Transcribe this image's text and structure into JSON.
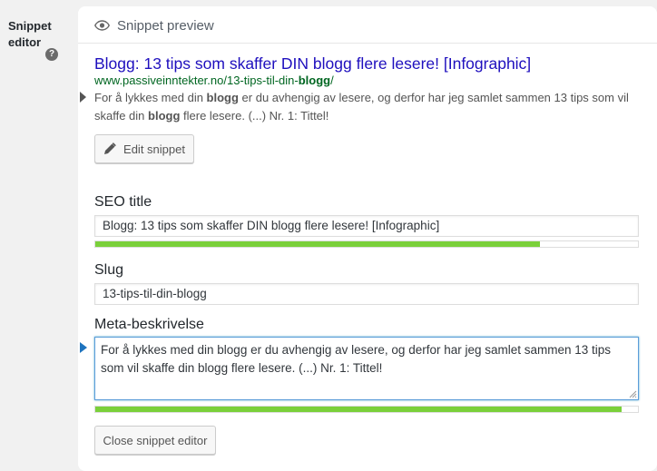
{
  "sidebar": {
    "label": "Snippet editor"
  },
  "preview": {
    "header": "Snippet preview",
    "serp_title": "Blogg: 13 tips som skaffer DIN blogg flere lesere! [Infographic]",
    "serp_url_prefix": "www.passiveinntekter.no/13-tips-til-din-",
    "serp_url_bold": "blogg",
    "serp_url_suffix": "/",
    "serp_desc_1": "For å lykkes med din ",
    "serp_desc_bold_1": "blogg",
    "serp_desc_2": " er du avhengig av lesere, og derfor har jeg samlet sammen 13 tips som vil skaffe din ",
    "serp_desc_bold_2": "blogg",
    "serp_desc_3": " flere lesere. (...) Nr. 1: Tittel!"
  },
  "edit_button": {
    "label": "Edit snippet",
    "icon": "pencil-icon"
  },
  "seo_title": {
    "label": "SEO title",
    "value": "Blogg: 13 tips som skaffer DIN blogg flere lesere! [Infographic]",
    "progress": 0.82,
    "progress_color": "#7ad03a"
  },
  "slug": {
    "label": "Slug",
    "value": "13-tips-til-din-blogg"
  },
  "meta": {
    "label": "Meta-beskrivelse",
    "value": "For å lykkes med din blogg er du avhengig av lesere, og derfor har jeg samlet sammen 13 tips som vil skaffe din blogg flere lesere. (...) Nr. 1: Tittel!",
    "progress": 0.97,
    "progress_color": "#7ad03a"
  },
  "close_button": {
    "label": "Close snippet editor"
  },
  "colors": {
    "link": "#1e0fbe",
    "url": "#006621",
    "accent": "#1e73be"
  }
}
